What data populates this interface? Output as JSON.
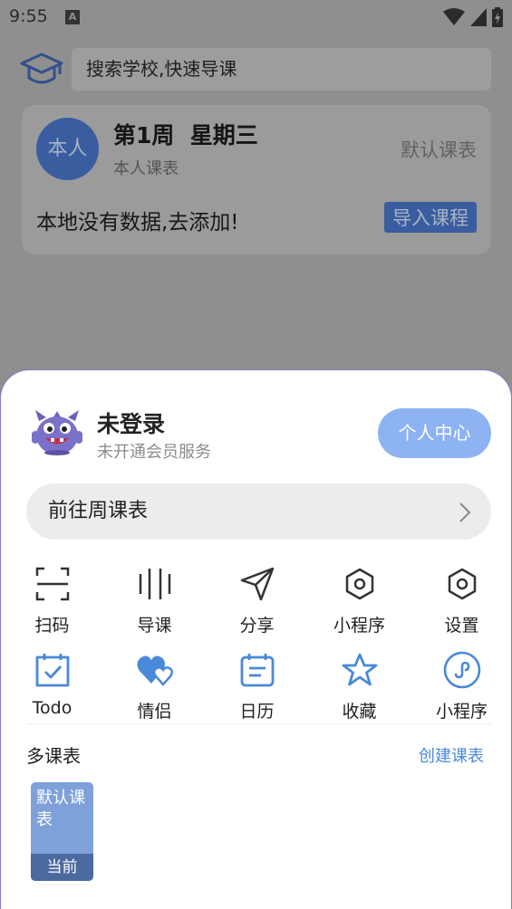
{
  "status_bar": {
    "time": "9:55",
    "notification_glyph": "A"
  },
  "home": {
    "search_placeholder": "搜索学校,快速导课",
    "avatar_text": "本人",
    "week_label": "第1周  星期三",
    "owner_label": "本人课表",
    "table_name": "默认课表",
    "empty_message": "本地没有数据,去添加!",
    "import_button": "导入课程"
  },
  "sheet": {
    "login_status": "未登录",
    "membership_status": "未开通会员服务",
    "profile_button": "个人中心",
    "weekly_schedule_link": "前往周课表",
    "menu_row1": [
      {
        "label": "扫码",
        "icon": "scan-icon"
      },
      {
        "label": "导课",
        "icon": "import-lines-icon"
      },
      {
        "label": "分享",
        "icon": "share-arrow-icon"
      },
      {
        "label": "小程序",
        "icon": "hexagon-nut-icon"
      },
      {
        "label": "设置",
        "icon": "settings-hexagon-icon"
      }
    ],
    "menu_row2": [
      {
        "label": "Todo",
        "icon": "todo-calendar-check-icon"
      },
      {
        "label": "情侣",
        "icon": "couple-hearts-icon"
      },
      {
        "label": "日历",
        "icon": "calendar-icon"
      },
      {
        "label": "收藏",
        "icon": "star-icon"
      },
      {
        "label": "小程序",
        "icon": "mini-program-icon"
      }
    ],
    "multi_schedule_title": "多课表",
    "create_schedule_link": "创建课表",
    "schedules": [
      {
        "name": "默认课表",
        "badge": "当前"
      }
    ]
  },
  "colors": {
    "accent_blue": "#4a89d9",
    "profile_button": "#8db3f3",
    "schedule_card": "#7ea1da"
  }
}
